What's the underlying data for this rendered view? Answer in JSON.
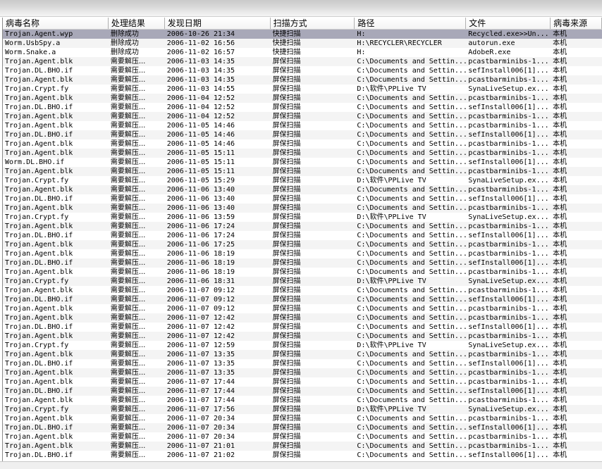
{
  "columns": [
    "病毒名称",
    "处理结果",
    "发现日期",
    "扫描方式",
    "路径",
    "文件",
    "病毒来源"
  ],
  "rows": [
    [
      "Trojan.Agent.wyp",
      "删除成功",
      "2006-10-26 21:34",
      "快捷扫描",
      "H:",
      "Recycled.exe>>Un...",
      "本机"
    ],
    [
      "Worm.UsbSpy.a",
      "删除成功",
      "2006-11-02 16:56",
      "快捷扫描",
      "H:\\RECYCLER\\RECYCLER",
      "autorun.exe",
      "本机"
    ],
    [
      "Worm.Snake.a",
      "删除成功",
      "2006-11-02 16:57",
      "快捷扫描",
      "H:",
      "AdobeR.exe",
      "本机"
    ],
    [
      "Trojan.Agent.blk",
      "需要解压...",
      "2006-11-03 14:35",
      "屏保扫描",
      "C:\\Documents and Settin...",
      "pcastbarminibs-1...",
      "本机"
    ],
    [
      "Trojan.DL.BHO.if",
      "需要解压...",
      "2006-11-03 14:35",
      "屏保扫描",
      "C:\\Documents and Settin...",
      "sefInstall006[1]...",
      "本机"
    ],
    [
      "Trojan.Agent.blk",
      "需要解压...",
      "2006-11-03 14:35",
      "屏保扫描",
      "C:\\Documents and Settin...",
      "pcastbarminibs-1...",
      "本机"
    ],
    [
      "Trojan.Crypt.fy",
      "需要解压...",
      "2006-11-03 14:55",
      "屏保扫描",
      "D:\\软件\\PPLive TV",
      "SynaLiveSetup.ex...",
      "本机"
    ],
    [
      "Trojan.Agent.blk",
      "需要解压...",
      "2006-11-04 12:52",
      "屏保扫描",
      "C:\\Documents and Settin...",
      "pcastbarminibs-1...",
      "本机"
    ],
    [
      "Trojan.DL.BHO.if",
      "需要解压...",
      "2006-11-04 12:52",
      "屏保扫描",
      "C:\\Documents and Settin...",
      "sefInstall006[1]...",
      "本机"
    ],
    [
      "Trojan.Agent.blk",
      "需要解压...",
      "2006-11-04 12:52",
      "屏保扫描",
      "C:\\Documents and Settin...",
      "pcastbarminibs-1...",
      "本机"
    ],
    [
      "Trojan.Agent.blk",
      "需要解压...",
      "2006-11-05 14:46",
      "屏保扫描",
      "C:\\Documents and Settin...",
      "pcastbarminibs-1...",
      "本机"
    ],
    [
      "Trojan.DL.BHO.if",
      "需要解压...",
      "2006-11-05 14:46",
      "屏保扫描",
      "C:\\Documents and Settin...",
      "sefInstall006[1]...",
      "本机"
    ],
    [
      "Trojan.Agent.blk",
      "需要解压...",
      "2006-11-05 14:46",
      "屏保扫描",
      "C:\\Documents and Settin...",
      "pcastbarminibs-1...",
      "本机"
    ],
    [
      "Trojan.Agent.blk",
      "需要解压...",
      "2006-11-05 15:11",
      "屏保扫描",
      "C:\\Documents and Settin...",
      "pcastbarminibs-1...",
      "本机"
    ],
    [
      "Worm.DL.BHO.if",
      "需要解压...",
      "2006-11-05 15:11",
      "屏保扫描",
      "C:\\Documents and Settin...",
      "sefInstall006[1]...",
      "本机"
    ],
    [
      "Trojan.Agent.blk",
      "需要解压...",
      "2006-11-05 15:11",
      "屏保扫描",
      "C:\\Documents and Settin...",
      "pcastbarminibs-1...",
      "本机"
    ],
    [
      "Trojan.Crypt.fy",
      "需要解压...",
      "2006-11-05 15:29",
      "屏保扫描",
      "D:\\软件\\PPLive TV",
      "SynaLiveSetup.ex...",
      "本机"
    ],
    [
      "Trojan.Agent.blk",
      "需要解压...",
      "2006-11-06 13:40",
      "屏保扫描",
      "C:\\Documents and Settin...",
      "pcastbarminibs-1...",
      "本机"
    ],
    [
      "Trojan.DL.BHO.if",
      "需要解压...",
      "2006-11-06 13:40",
      "屏保扫描",
      "C:\\Documents and Settin...",
      "sefInstall006[1]...",
      "本机"
    ],
    [
      "Trojan.Agent.blk",
      "需要解压...",
      "2006-11-06 13:40",
      "屏保扫描",
      "C:\\Documents and Settin...",
      "pcastbarminibs-1...",
      "本机"
    ],
    [
      "Trojan.Crypt.fy",
      "需要解压...",
      "2006-11-06 13:59",
      "屏保扫描",
      "D:\\软件\\PPLive TV",
      "SynaLiveSetup.ex...",
      "本机"
    ],
    [
      "Trojan.Agent.blk",
      "需要解压...",
      "2006-11-06 17:24",
      "屏保扫描",
      "C:\\Documents and Settin...",
      "pcastbarminibs-1...",
      "本机"
    ],
    [
      "Trojan.DL.BHO.if",
      "需要解压...",
      "2006-11-06 17:24",
      "屏保扫描",
      "C:\\Documents and Settin...",
      "sefInstall006[1]...",
      "本机"
    ],
    [
      "Trojan.Agent.blk",
      "需要解压...",
      "2006-11-06 17:25",
      "屏保扫描",
      "C:\\Documents and Settin...",
      "pcastbarminibs-1...",
      "本机"
    ],
    [
      "Trojan.Agent.blk",
      "需要解压...",
      "2006-11-06 18:19",
      "屏保扫描",
      "C:\\Documents and Settin...",
      "pcastbarminibs-1...",
      "本机"
    ],
    [
      "Trojan.DL.BHO.if",
      "需要解压...",
      "2006-11-06 18:19",
      "屏保扫描",
      "C:\\Documents and Settin...",
      "sefInstall006[1]...",
      "本机"
    ],
    [
      "Trojan.Agent.blk",
      "需要解压...",
      "2006-11-06 18:19",
      "屏保扫描",
      "C:\\Documents and Settin...",
      "pcastbarminibs-1...",
      "本机"
    ],
    [
      "Trojan.Crypt.fy",
      "需要解压...",
      "2006-11-06 18:31",
      "屏保扫描",
      "D:\\软件\\PPLive TV",
      "SynaLiveSetup.ex...",
      "本机"
    ],
    [
      "Trojan.Agent.blk",
      "需要解压...",
      "2006-11-07 09:12",
      "屏保扫描",
      "C:\\Documents and Settin...",
      "pcastbarminibs-1...",
      "本机"
    ],
    [
      "Trojan.DL.BHO.if",
      "需要解压...",
      "2006-11-07 09:12",
      "屏保扫描",
      "C:\\Documents and Settin...",
      "sefInstall006[1]...",
      "本机"
    ],
    [
      "Trojan.Agent.blk",
      "需要解压...",
      "2006-11-07 09:12",
      "屏保扫描",
      "C:\\Documents and Settin...",
      "pcastbarminibs-1...",
      "本机"
    ],
    [
      "Trojan.Agent.blk",
      "需要解压...",
      "2006-11-07 12:42",
      "屏保扫描",
      "C:\\Documents and Settin...",
      "pcastbarminibs-1...",
      "本机"
    ],
    [
      "Trojan.DL.BHO.if",
      "需要解压...",
      "2006-11-07 12:42",
      "屏保扫描",
      "C:\\Documents and Settin...",
      "sefInstall006[1]...",
      "本机"
    ],
    [
      "Trojan.Agent.blk",
      "需要解压...",
      "2006-11-07 12:42",
      "屏保扫描",
      "C:\\Documents and Settin...",
      "pcastbarminibs-1...",
      "本机"
    ],
    [
      "Trojan.Crypt.fy",
      "需要解压...",
      "2006-11-07 12:59",
      "屏保扫描",
      "D:\\软件\\PPLive TV",
      "SynaLiveSetup.ex...",
      "本机"
    ],
    [
      "Trojan.Agent.blk",
      "需要解压...",
      "2006-11-07 13:35",
      "屏保扫描",
      "C:\\Documents and Settin...",
      "pcastbarminibs-1...",
      "本机"
    ],
    [
      "Trojan.DL.BHO.if",
      "需要解压...",
      "2006-11-07 13:35",
      "屏保扫描",
      "C:\\Documents and Settin...",
      "sefInstall006[1]...",
      "本机"
    ],
    [
      "Trojan.Agent.blk",
      "需要解压...",
      "2006-11-07 13:35",
      "屏保扫描",
      "C:\\Documents and Settin...",
      "pcastbarminibs-1...",
      "本机"
    ],
    [
      "Trojan.Agent.blk",
      "需要解压...",
      "2006-11-07 17:44",
      "屏保扫描",
      "C:\\Documents and Settin...",
      "pcastbarminibs-1...",
      "本机"
    ],
    [
      "Trojan.DL.BHO.if",
      "需要解压...",
      "2006-11-07 17:44",
      "屏保扫描",
      "C:\\Documents and Settin...",
      "sefInstall006[1]...",
      "本机"
    ],
    [
      "Trojan.Agent.blk",
      "需要解压...",
      "2006-11-07 17:44",
      "屏保扫描",
      "C:\\Documents and Settin...",
      "pcastbarminibs-1...",
      "本机"
    ],
    [
      "Trojan.Crypt.fy",
      "需要解压...",
      "2006-11-07 17:56",
      "屏保扫描",
      "D:\\软件\\PPLive TV",
      "SynaLiveSetup.ex...",
      "本机"
    ],
    [
      "Trojan.Agent.blk",
      "需要解压...",
      "2006-11-07 20:34",
      "屏保扫描",
      "C:\\Documents and Settin...",
      "pcastbarminibs-1...",
      "本机"
    ],
    [
      "Trojan.DL.BHO.if",
      "需要解压...",
      "2006-11-07 20:34",
      "屏保扫描",
      "C:\\Documents and Settin...",
      "sefInstall006[1]...",
      "本机"
    ],
    [
      "Trojan.Agent.blk",
      "需要解压...",
      "2006-11-07 20:34",
      "屏保扫描",
      "C:\\Documents and Settin...",
      "pcastbarminibs-1...",
      "本机"
    ],
    [
      "Trojan.Agent.blk",
      "需要解压...",
      "2006-11-07 21:01",
      "屏保扫描",
      "C:\\Documents and Settin...",
      "pcastbarminibs-1...",
      "本机"
    ],
    [
      "Trojan.DL.BHO.if",
      "需要解压...",
      "2006-11-07 21:02",
      "屏保扫描",
      "C:\\Documents and Settin...",
      "sefInstall006[1]...",
      "本机"
    ]
  ],
  "selected_row": 0,
  "colors": {
    "selected_row": "#a8a8b8",
    "alt_row": "#f4f4f4",
    "header_border": "#b0b0b0"
  }
}
